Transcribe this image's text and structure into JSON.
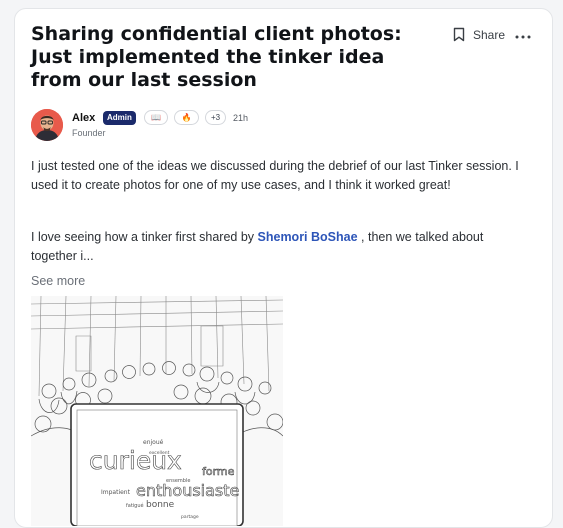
{
  "post": {
    "title": "Sharing confidential client photos: Just implemented the tinker idea from our last session",
    "actions": {
      "share_label": "Share"
    },
    "author": {
      "name": "Alex",
      "role_badge": "Admin",
      "chips": {
        "book": "📖",
        "fire": "🔥",
        "more": "+3"
      },
      "time": "21h",
      "title": "Founder"
    },
    "body": {
      "p1": "I just tested one of the ideas we discussed during the debrief of our last Tinker session. I used it to create photos for one of my use cases, and I think it worked great!",
      "p2_before": "I love seeing how a tinker first shared by ",
      "p2_mention": "Shemori BoShae",
      "p2_after": " , then we talked about together i...",
      "see_more": "See more"
    },
    "image": {
      "words": [
        "enjoué",
        "curieux",
        "forme",
        "enthousiaste",
        "bonne",
        "fatigué",
        "Impatient",
        "ensemble",
        "excellent",
        "partage"
      ]
    }
  },
  "colors": {
    "badge": "#1b2a6b",
    "mention": "#2d55b8",
    "avatar_bg": "#e85a4b"
  }
}
